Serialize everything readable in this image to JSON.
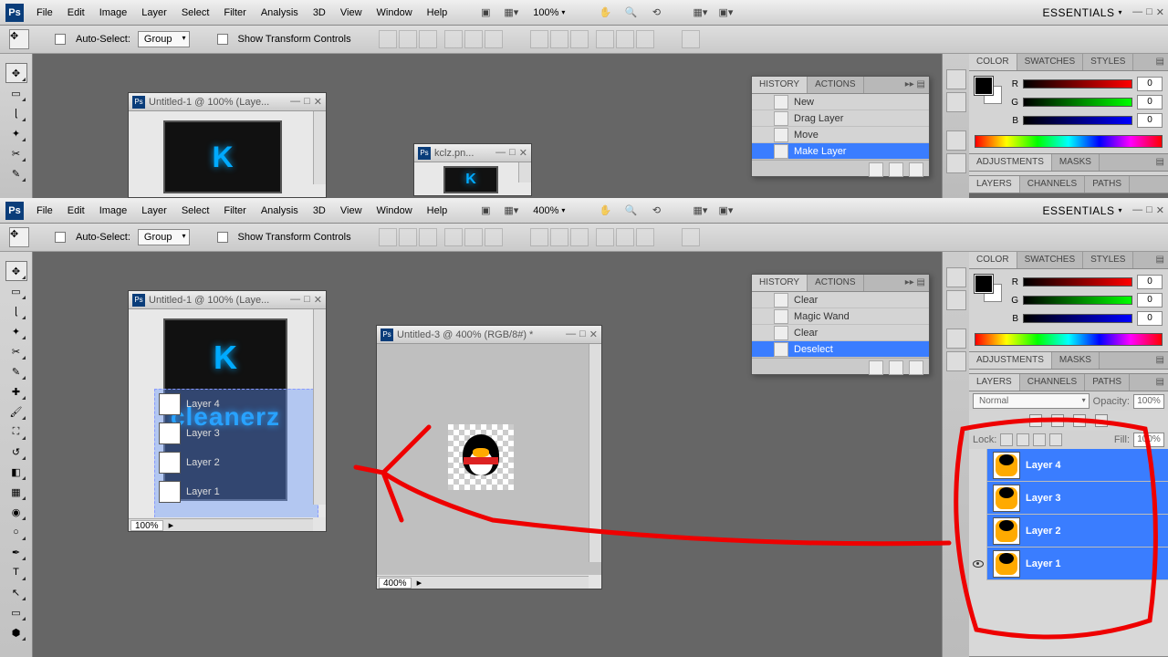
{
  "menubar": {
    "items": [
      "File",
      "Edit",
      "Image",
      "Layer",
      "Select",
      "Filter",
      "Analysis",
      "3D",
      "View",
      "Window",
      "Help"
    ],
    "essentials": "ESSENTIALS"
  },
  "instance1": {
    "zoom": "100%",
    "options": {
      "autoSelect": "Auto-Select:",
      "group": "Group",
      "transformCtrls": "Show Transform Controls"
    },
    "doc1": {
      "title": "Untitled-1 @ 100% (Laye...",
      "zoom": "100%"
    },
    "doc2": {
      "title": "kclz.pn..."
    },
    "history": {
      "tabs": [
        "HISTORY",
        "ACTIONS"
      ],
      "items": [
        {
          "label": "New"
        },
        {
          "label": "Drag Layer"
        },
        {
          "label": "Move"
        },
        {
          "label": "Make Layer",
          "selected": true
        }
      ]
    },
    "color": {
      "tabs": [
        "COLOR",
        "SWATCHES",
        "STYLES"
      ],
      "r": "0",
      "g": "0",
      "b": "0"
    },
    "adjustments": {
      "tabs": [
        "ADJUSTMENTS",
        "MASKS"
      ]
    },
    "layers": {
      "tabs": [
        "LAYERS",
        "CHANNELS",
        "PATHS"
      ]
    }
  },
  "instance2": {
    "zoom": "400%",
    "options": {
      "autoSelect": "Auto-Select:",
      "group": "Group",
      "transformCtrls": "Show Transform Controls"
    },
    "doc1": {
      "title": "Untitled-1 @ 100% (Laye...",
      "zoom": "100%",
      "dragLayers": [
        "Layer 4",
        "Layer 3",
        "Layer 2",
        "Layer 1"
      ],
      "cleanerz": "cleanerz"
    },
    "doc3": {
      "title": "Untitled-3 @ 400% (RGB/8#) *",
      "zoom": "400%"
    },
    "history": {
      "tabs": [
        "HISTORY",
        "ACTIONS"
      ],
      "items": [
        {
          "label": "Clear"
        },
        {
          "label": "Magic Wand"
        },
        {
          "label": "Clear"
        },
        {
          "label": "Deselect",
          "selected": true
        }
      ]
    },
    "color": {
      "tabs": [
        "COLOR",
        "SWATCHES",
        "STYLES"
      ],
      "r": "0",
      "g": "0",
      "b": "0"
    },
    "adjustments": {
      "tabs": [
        "ADJUSTMENTS",
        "MASKS"
      ]
    },
    "layers": {
      "tabs": [
        "LAYERS",
        "CHANNELS",
        "PATHS"
      ],
      "blend": "Normal",
      "opacityLabel": "Opacity:",
      "opacity": "100%",
      "lockLabel": "Lock:",
      "fillLabel": "Fill:",
      "fill": "100%",
      "items": [
        {
          "name": "Layer 4",
          "visible": false,
          "selected": true
        },
        {
          "name": "Layer 3",
          "visible": false,
          "selected": true
        },
        {
          "name": "Layer 2",
          "visible": false,
          "selected": true
        },
        {
          "name": "Layer 1",
          "visible": true,
          "selected": true
        }
      ]
    }
  }
}
